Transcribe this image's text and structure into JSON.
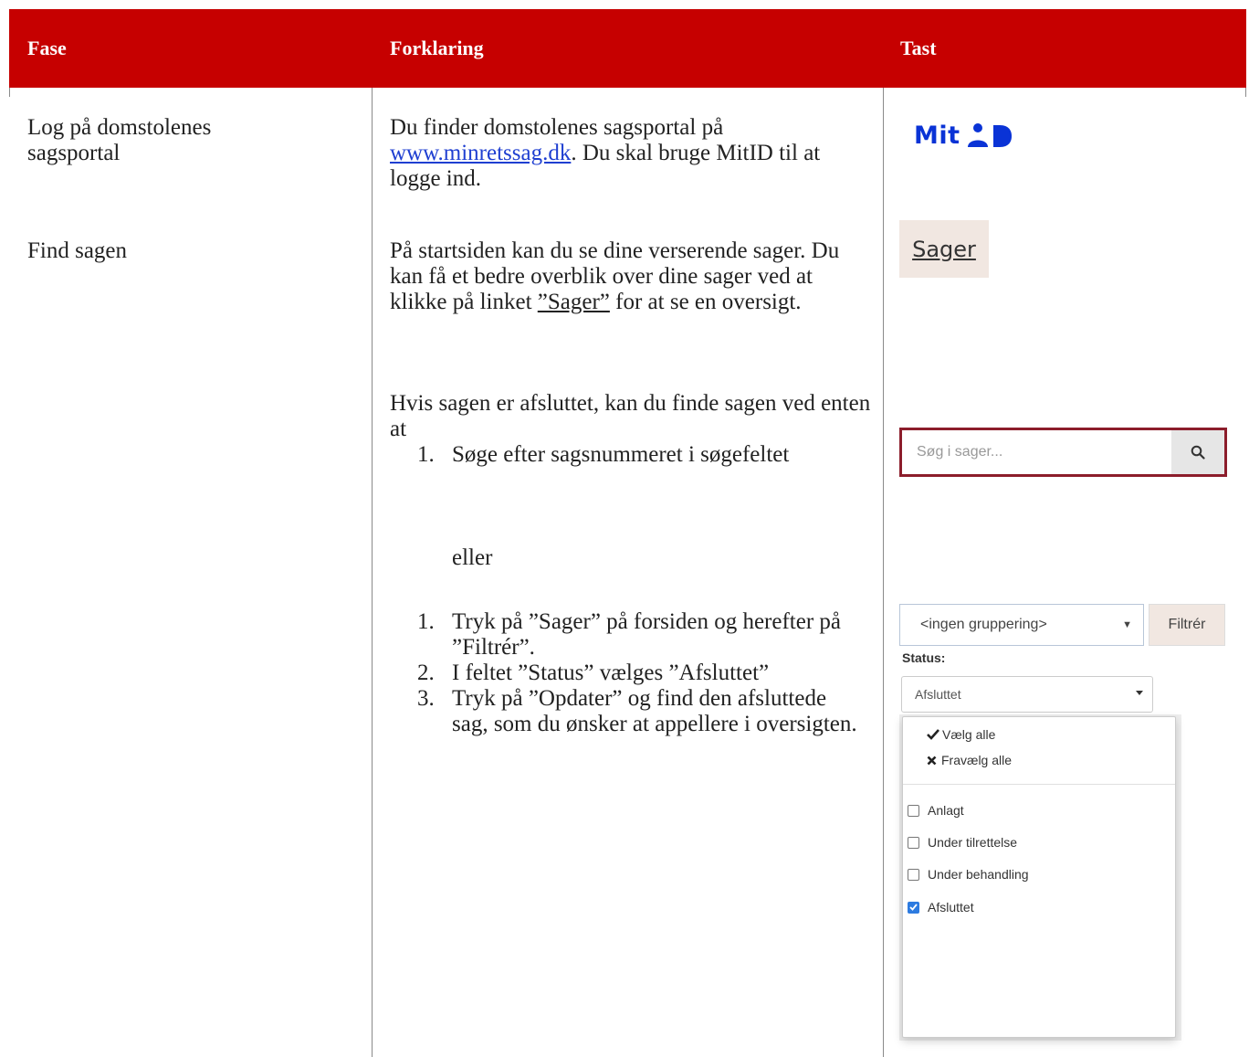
{
  "header": {
    "col_phase": "Fase",
    "col_explanation": "Forklaring",
    "col_key": "Tast"
  },
  "rows": [
    {
      "phase": "Log på domstolenes sagsportal",
      "explanation_pre": "Du finder domstolenes sagsportal på ",
      "link_text": "www.minretssag.dk",
      "explanation_post": ". Du skal bruge MitID til at logge ind."
    },
    {
      "phase": "Find sagen",
      "para1_pre": "På startsiden kan du se dine verserende sager. Du kan få et bedre overblik over dine sager ved at klikke på linket ",
      "para1_link": "”Sager”",
      "para1_post": " for at se en oversigt.",
      "para2": "Hvis sagen er afsluttet, kan du finde sagen ved enten at",
      "list1": [
        {
          "num": "1.",
          "text": "Søge efter sagsnummeret i søgefeltet"
        }
      ],
      "or_text": "eller",
      "list2": [
        {
          "num": "1.",
          "text": "Tryk på ”Sager” på forsiden og herefter på ”Filtrér”."
        },
        {
          "num": "2.",
          "text": "I feltet ”Status” vælges ”Afsluttet”"
        },
        {
          "num": "3.",
          "text": "Tryk på ”Opdater” og find den afsluttede sag, som du ønsker at appellere i oversigten."
        }
      ]
    }
  ],
  "key_column": {
    "mitid_logo_text": "MitID",
    "sager_button": "Sager",
    "search_placeholder": "Søg i sager...",
    "grouping_select": "<ingen gruppering>",
    "filter_button": "Filtrér",
    "status_label": "Status:",
    "status_select": "Afsluttet",
    "select_all": "Vælg alle",
    "deselect_all": "Fravælg alle",
    "options": [
      {
        "label": "Anlagt",
        "checked": false
      },
      {
        "label": "Under tilrettelse",
        "checked": false
      },
      {
        "label": "Under behandling",
        "checked": false
      },
      {
        "label": "Afsluttet",
        "checked": true
      }
    ]
  },
  "colors": {
    "header_red": "#c60000",
    "link_blue": "#1f3fd1",
    "mitid_blue": "#0a33d6",
    "search_border": "#8c1d2b",
    "checkbox_blue": "#2d7be0"
  },
  "icons": [
    "mitid-logo-icon",
    "search-icon",
    "check-icon",
    "cross-icon",
    "chevron-down-icon",
    "checkbox-icon"
  ]
}
